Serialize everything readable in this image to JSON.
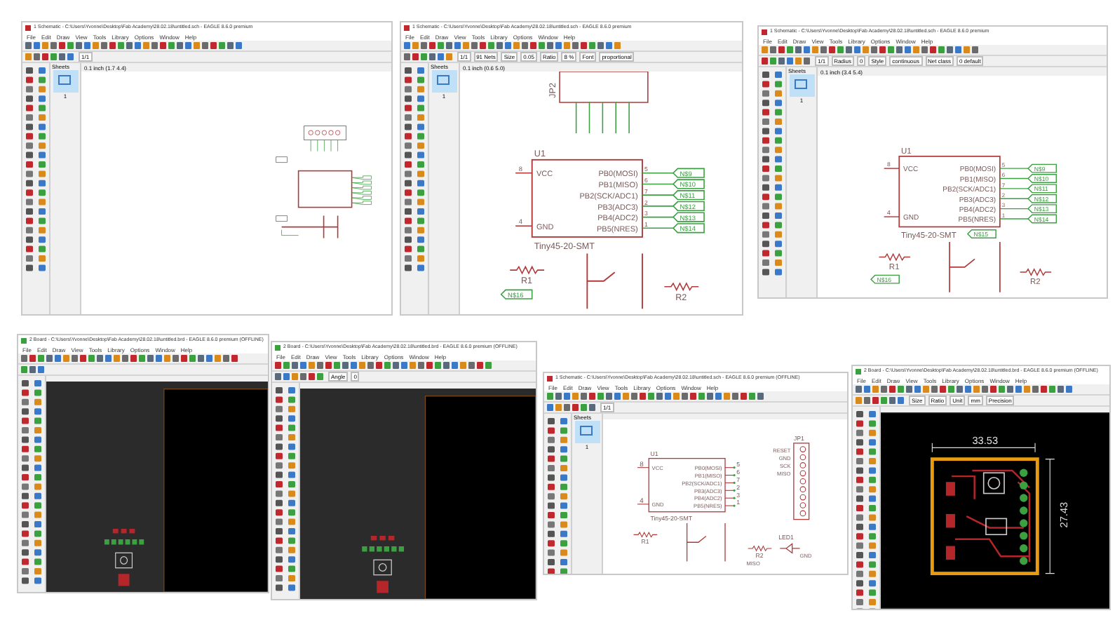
{
  "windows": [
    {
      "kind": "schematic",
      "title": "1 Schematic - C:\\Users\\Yvonne\\Desktop\\Fab Academy\\28.02.18\\untitled.sch - EAGLE 8.6.0 premium",
      "menu": [
        "File",
        "Edit",
        "Draw",
        "View",
        "Tools",
        "Library",
        "Options",
        "Window",
        "Help"
      ],
      "fields": [
        "1/1"
      ],
      "sheets": {
        "label": "Sheets",
        "page": "1"
      },
      "coordinates": "0.1 inch (1.7 4.4)"
    },
    {
      "kind": "schematic",
      "title": "1 Schematic - C:\\Users\\Yvonne\\Desktop\\Fab Academy\\28.02.18\\untitled.sch - EAGLE 8.6.0 premium",
      "menu": [
        "File",
        "Edit",
        "Draw",
        "View",
        "Tools",
        "Library",
        "Options",
        "Window",
        "Help"
      ],
      "fields": [
        "1/1",
        "91 Nets",
        "Size",
        "0.05",
        "Ratio",
        "8 %",
        "Font",
        "proportional"
      ],
      "sheets": {
        "label": "Sheets",
        "page": "1"
      },
      "coordinates": "0.1 inch (0.6 5.0)",
      "header": {
        "ref": "JP2"
      },
      "chip": {
        "ref": "U1",
        "part": "Tiny45-20-SMT",
        "left_pins": [
          {
            "name": "VCC",
            "number": "8"
          },
          {
            "name": "GND",
            "number": "4"
          }
        ],
        "right_pins": [
          {
            "name": "PB0(MOSI)",
            "number": "5",
            "net": "N$9"
          },
          {
            "name": "PB1(MISO)",
            "number": "6",
            "net": "N$10"
          },
          {
            "name": "PB2(SCK/ADC1)",
            "number": "7",
            "net": "N$11"
          },
          {
            "name": "PB3(ADC3)",
            "number": "2",
            "net": "N$12"
          },
          {
            "name": "PB4(ADC2)",
            "number": "3",
            "net": "N$13"
          },
          {
            "name": "PB5(NRES)",
            "number": "1",
            "net": "N$14"
          }
        ]
      },
      "resistors": [
        {
          "ref": "R1",
          "net": "N$16"
        },
        {
          "ref": "R2"
        }
      ]
    },
    {
      "kind": "schematic",
      "title": "1 Schematic - C:\\Users\\Yvonne\\Desktop\\Fab Academy\\28.02.18\\untitled.sch - EAGLE 8.6.0 premium",
      "menu": [
        "File",
        "Edit",
        "Draw",
        "View",
        "Tools",
        "Library",
        "Options",
        "Window",
        "Help"
      ],
      "fields": [
        "1/1",
        "Radius",
        "0",
        "Style",
        "continuous",
        "Net class",
        "0 default"
      ],
      "sheets": {
        "label": "Sheets",
        "page": "1"
      },
      "coordinates": "0.1 inch (3.4 5.4)",
      "switch_net": "N$15",
      "chip": {
        "ref": "U1",
        "part": "Tiny45-20-SMT",
        "left_pins": [
          {
            "name": "VCC",
            "number": "8"
          },
          {
            "name": "GND",
            "number": "4"
          }
        ],
        "right_pins": [
          {
            "name": "PB0(MOSI)",
            "number": "5",
            "net": "N$9"
          },
          {
            "name": "PB1(MISO)",
            "number": "6",
            "net": "N$10"
          },
          {
            "name": "PB2(SCK/ADC1)",
            "number": "7",
            "net": "N$11"
          },
          {
            "name": "PB3(ADC3)",
            "number": "2",
            "net": "N$12"
          },
          {
            "name": "PB4(ADC2)",
            "number": "3",
            "net": "N$13"
          },
          {
            "name": "PB5(NRES)",
            "number": "1",
            "net": "N$14"
          }
        ]
      },
      "resistors": [
        {
          "ref": "R1",
          "net": "N$16"
        },
        {
          "ref": "R2"
        }
      ]
    },
    {
      "kind": "board",
      "title": "2 Board - C:\\Users\\Yvonne\\Desktop\\Fab Academy\\28.02.18\\untitled.brd - EAGLE 8.6.0 premium (OFFLINE)",
      "menu": [
        "File",
        "Edit",
        "Draw",
        "View",
        "Tools",
        "Library",
        "Options",
        "Window",
        "Help"
      ]
    },
    {
      "kind": "board",
      "title": "2 Board - C:\\Users\\Yvonne\\Desktop\\Fab Academy\\28.02.18\\untitled.brd - EAGLE 8.6.0 premium (OFFLINE)",
      "menu": [
        "File",
        "Edit",
        "Draw",
        "View",
        "Tools",
        "Library",
        "Options",
        "Window",
        "Help"
      ],
      "fields": [
        "Angle",
        "0"
      ]
    },
    {
      "kind": "schematic",
      "title": "1 Schematic - C:\\Users\\Yvonne\\Desktop\\Fab Academy\\28.02.18\\untitled.sch - EAGLE 8.6.0 premium (OFFLINE)",
      "menu": [
        "File",
        "Edit",
        "Draw",
        "View",
        "Tools",
        "Library",
        "Options",
        "Window",
        "Help"
      ],
      "fields": [
        "1/1"
      ],
      "sheets": {
        "label": "Sheets",
        "page": "1"
      },
      "chip": {
        "ref": "U1",
        "part": "Tiny45-20-SMT",
        "left_pins": [
          {
            "name": "VCC",
            "number": "8"
          },
          {
            "name": "GND",
            "number": "4"
          }
        ],
        "right_pins": [
          {
            "name": "PB0(MOSI)",
            "number": "5"
          },
          {
            "name": "PB1(MISO)",
            "number": "6"
          },
          {
            "name": "PB2(SCK/ADC1)",
            "number": "7"
          },
          {
            "name": "PB3(ADC3)",
            "number": "2"
          },
          {
            "name": "PB4(ADC2)",
            "number": "3"
          },
          {
            "name": "PB5(NRES)",
            "number": "1"
          }
        ]
      },
      "jp1": {
        "ref": "JP1",
        "labels": [
          "RESET",
          "GND",
          "SCK",
          "MISO"
        ]
      },
      "resistors": [
        {
          "ref": "R1"
        },
        {
          "ref": "R2",
          "net": "MISO"
        }
      ],
      "led": {
        "ref": "LED1",
        "net": "GND"
      }
    },
    {
      "kind": "board",
      "title": "2 Board - C:\\Users\\Yvonne\\Desktop\\Fab Academy\\28.02.18\\untitled.brd - EAGLE 8.6.0 premium (OFFLINE)",
      "menu": [
        "File",
        "Edit",
        "Draw",
        "View",
        "Tools",
        "Library",
        "Options",
        "Window",
        "Help"
      ],
      "fields": [
        "Size",
        "Ratio",
        "Unit",
        "mm",
        "Precision"
      ],
      "width_dim": "33.53",
      "height_dim": "27.43"
    }
  ]
}
